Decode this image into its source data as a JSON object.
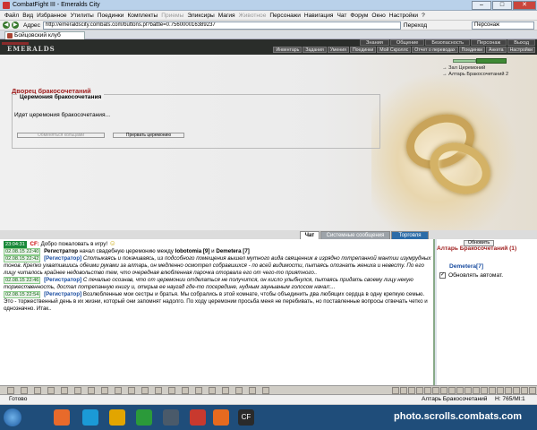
{
  "window": {
    "title": "CombatFight III - Emeralds City"
  },
  "menu": [
    "Файл",
    "Вид",
    "Избранное",
    "Утилиты",
    "Поединки",
    "Комплекты",
    "Приемы",
    "Эликсиры",
    "Магия",
    "Животное",
    "Персонажи",
    "Навигация",
    "Чат",
    "Форум",
    "Окно",
    "Настройки",
    "?"
  ],
  "menu_disabled": [
    6,
    9
  ],
  "address": {
    "label": "Адрес",
    "value": "http://emeraldscity.combats.com/buttons.pl?battle=0.756000016389237",
    "go": "Переход",
    "search": "Персонаж"
  },
  "tab": {
    "label": "Бойцовский клуб"
  },
  "game": {
    "logo": "EMERALDS",
    "topnav": [
      "Знания",
      "Общение",
      "Безопасность",
      "Персонаж",
      "Выход"
    ],
    "subnav": [
      "Инвентарь",
      "Задания",
      "Умения",
      "Поединки",
      "Мой Скроллс",
      "Отчет о переводах",
      "Поединки",
      "Анкета",
      "Настройки"
    ]
  },
  "palace": {
    "title": "Дворец бракосочетаний",
    "legend": "Церемония бракосочетания",
    "status": "Идет церемония бракосочетания...",
    "btn_rings": "Обменяться кольцами",
    "btn_stop": "Прервать церемонию"
  },
  "right_links": [
    "→ Зал Церемоний",
    "→ Алтарь Бракосочетаний 2"
  ],
  "chat_tabs": [
    "Чат",
    "Системные сообщения",
    "Торговля"
  ],
  "chat": {
    "welcome_time": "23:04:31",
    "welcome_prefix": "CF:",
    "welcome": "Добро пожаловать в игру!",
    "l2_time": "02.08.15 22:40",
    "l2_who": "Регистратор",
    "l2_a": "начал свадебную церемонию между",
    "l2_u1": "Iobotomia [9]",
    "l2_and": "и",
    "l2_u2": "Demetera [7]",
    "l3_time": "02.08.15 22:42",
    "l3_who": "[Регистратор]",
    "l3_text": "Спотыкаясь и покачиваясь, из подсобного помещения вышел мутного вида священник в изрядно потрепанной мантии изумрудных тонов. Крепко ухватившись обеими руками за алтарь, он медленно осмотрел собравшихся - по всей видимости, пытаясь опознать жениха и невесту. По его лицу читалось крайнее недовольство тем, что очередная влюбленная парочка оторвала его от чего-то приятного..",
    "l4_time": "02.08.15 22:46",
    "l4_who": "[Регистратор]",
    "l4_text": "С печалью осознав, что от церемонии отделаться не получится, он кисло улыбнулся, пытаясь придать своему лицу некую торжественность, достал потрепанную книгу и, открыв ее наугад где-то посередине, нудным заунывным голосом начал:...",
    "l5_time": "02.08.15 22:54",
    "l5_who": "[Регистратор]",
    "l5_text": "Возлюбленные мои сестры и братья. Мы собрались в этой комнате, чтобы объединить два любящих сердца в одну крепкую семью. Это - торжественный день в их жизни, который они запомнят надолго. По ходу церемонии просьба меня не перебивать, но поставленные вопросы отвечать четко и однозначно. Итак.."
  },
  "side": {
    "refresh": "Обновить",
    "title": "Алтарь Бракосочетаний (1)",
    "user": "Demetera[7]",
    "auto": "Обновлять автомат."
  },
  "status": {
    "ready": "Готово",
    "location": "Алтарь Бракосочетаний",
    "hp": "Н: 765/Ml:1"
  },
  "watermark": "photo.scrolls.combats.com",
  "colors": {
    "accent_red": "#a02020",
    "link_blue": "#1a4da0",
    "taskbar": "#1f4d7a"
  }
}
